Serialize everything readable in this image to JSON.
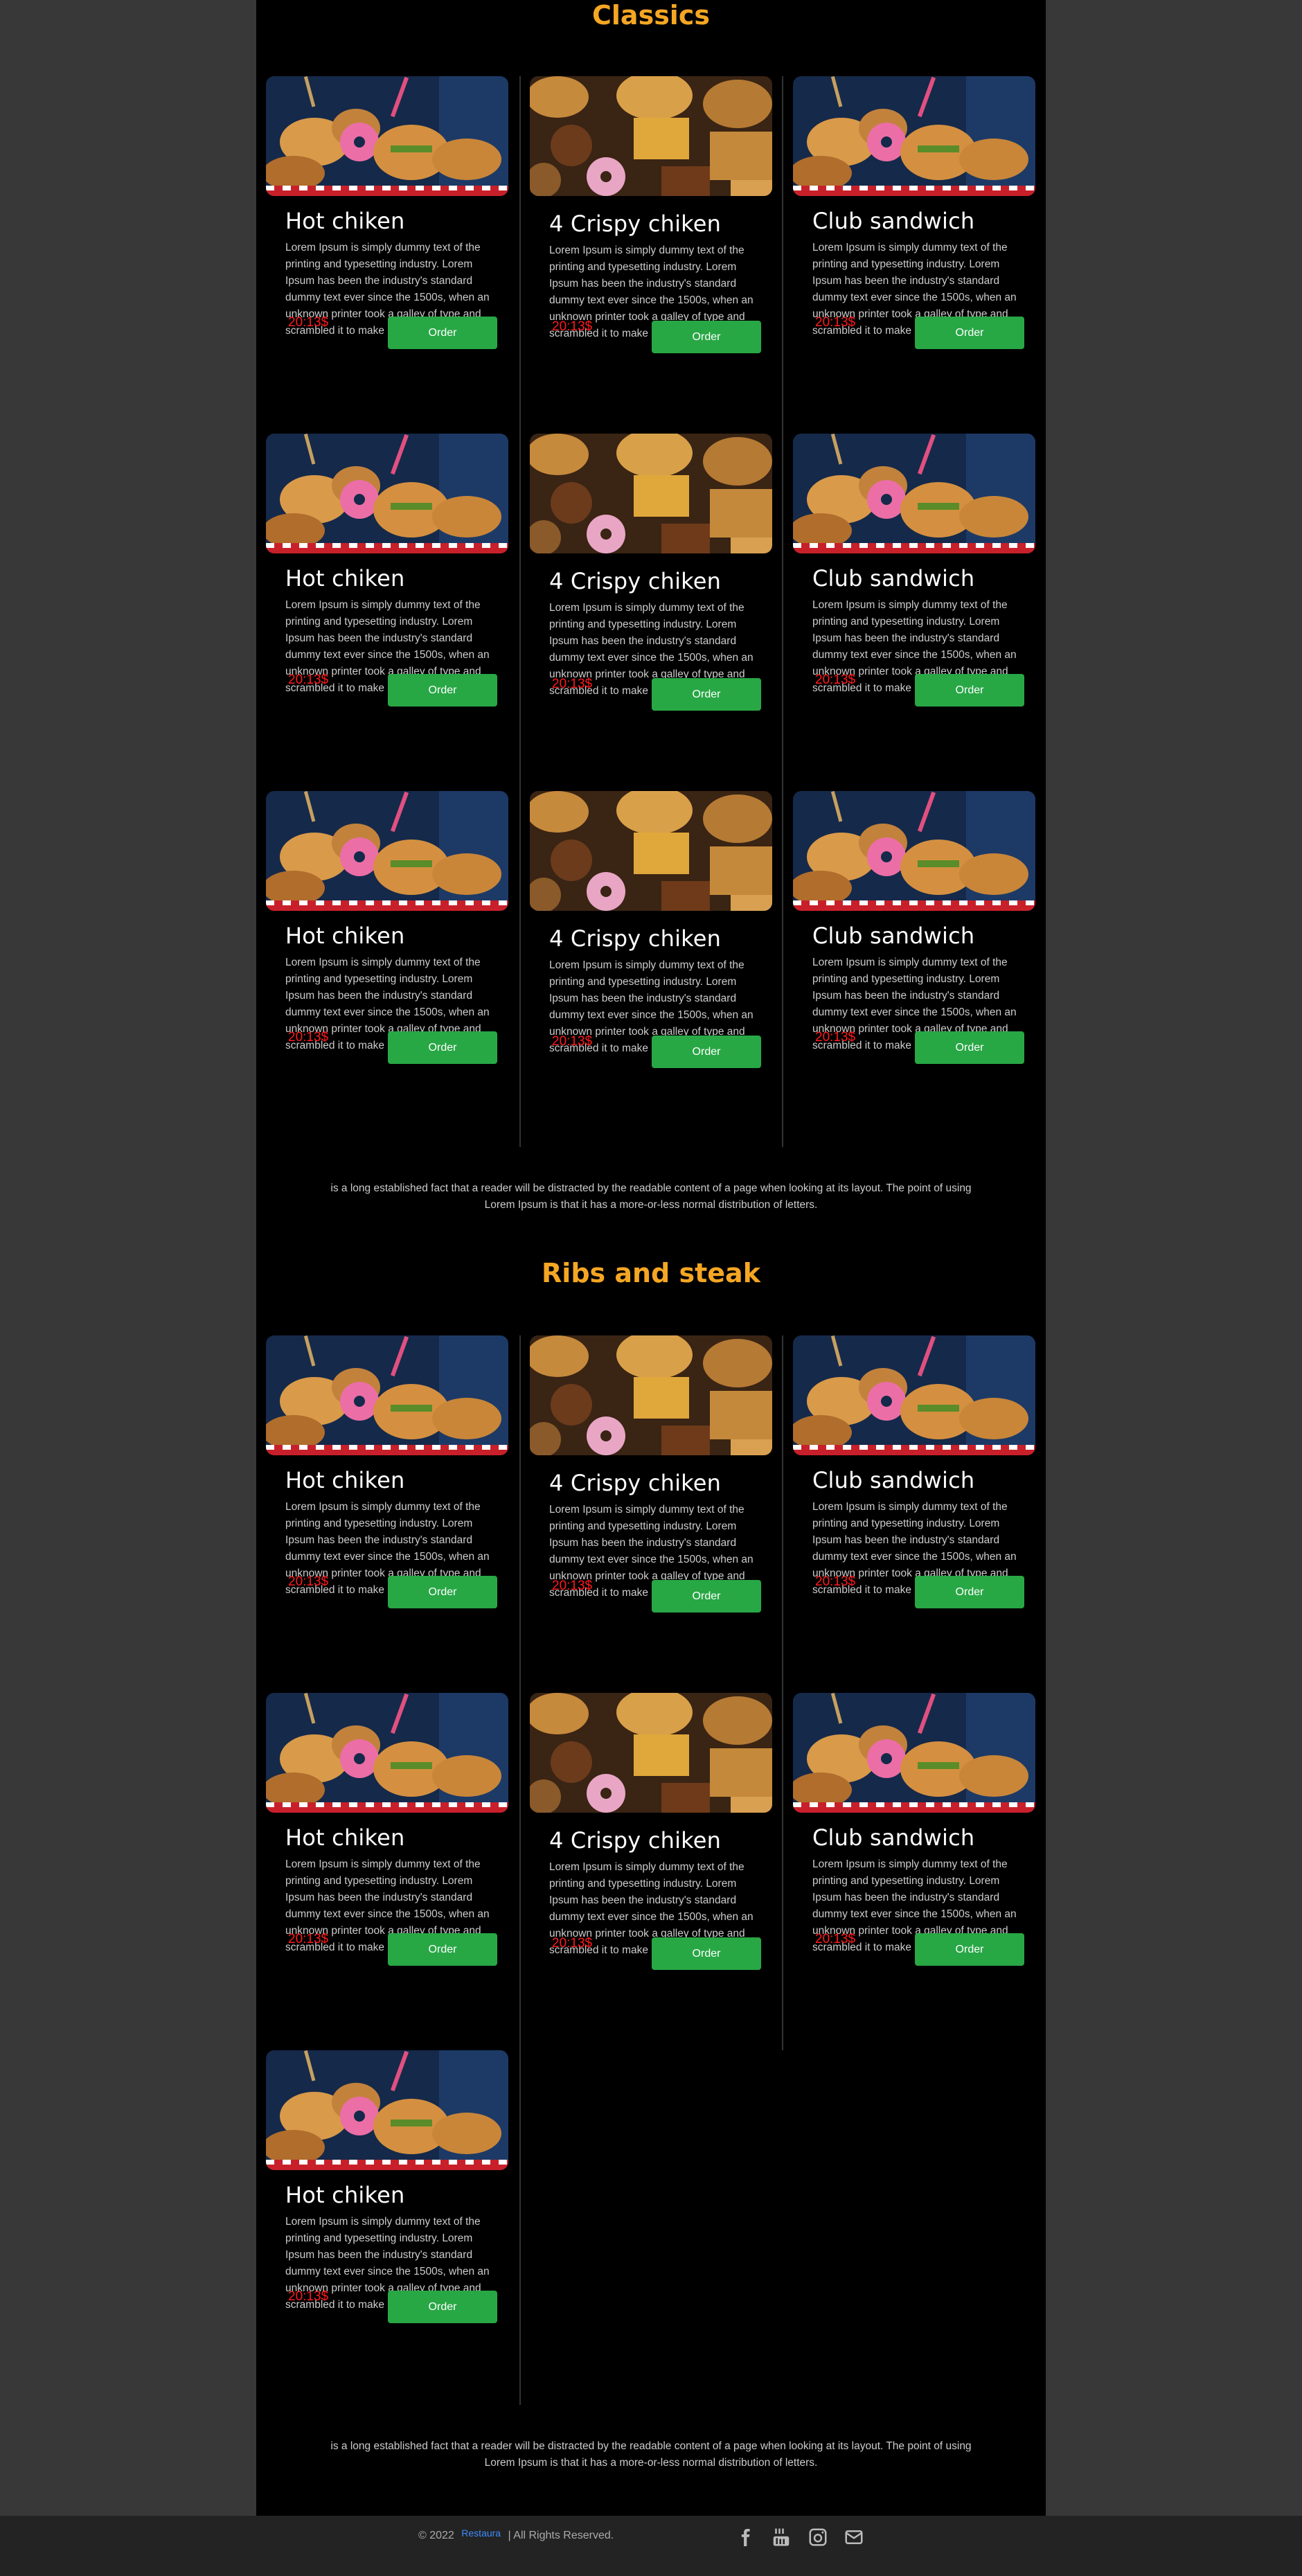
{
  "sections": [
    {
      "title": "Classics",
      "note": "is a long established fact that a reader will be distracted by the readable content of a page when looking at its layout. The point of using Lorem Ipsum is that it has a more-or-less normal distribution of letters."
    },
    {
      "title": "Ribs and steak",
      "note": "is a long established fact that a reader will be distracted by the readable content of a page when looking at its layout. The point of using Lorem Ipsum is that it has a more-or-less normal distribution of letters."
    }
  ],
  "cards": {
    "hot": {
      "title": "Hot chiken",
      "text": "Lorem Ipsum is simply dummy text of the printing and typesetting industry. Lorem Ipsum has been the industry's standard dummy text ever since the 1500s, when an unknown printer took a galley of type and scrambled it to make a type specimen book",
      "price": "20:13$",
      "order": "Order"
    },
    "crispy": {
      "title": "4 Crispy chiken",
      "text": "Lorem Ipsum is simply dummy text of the printing and typesetting industry. Lorem Ipsum has been the industry's standard dummy text ever since the 1500s, when an unknown printer took a galley of type and scrambled it to make a type specimen book",
      "price": "20:13$",
      "order": "Order"
    },
    "club": {
      "title": "Club sandwich",
      "text": "Lorem Ipsum is simply dummy text of the printing and typesetting industry. Lorem Ipsum has been the industry's standard dummy text ever since the 1500s, when an unknown printer took a galley of type and scrambled it to make a type specimen book",
      "price": "20:13$",
      "order": "Order"
    }
  },
  "footer": {
    "copyright": "© 2022",
    "brand": "Restaura",
    "rights": "| All Rights Reserved.",
    "social": [
      "facebook-icon",
      "youtube-icon",
      "instagram-icon",
      "mail-icon"
    ]
  },
  "colors": {
    "accent": "#f5a623",
    "price": "#ff1a1a",
    "button": "#28a745",
    "page_bg": "#383838",
    "content_bg": "#000000"
  }
}
